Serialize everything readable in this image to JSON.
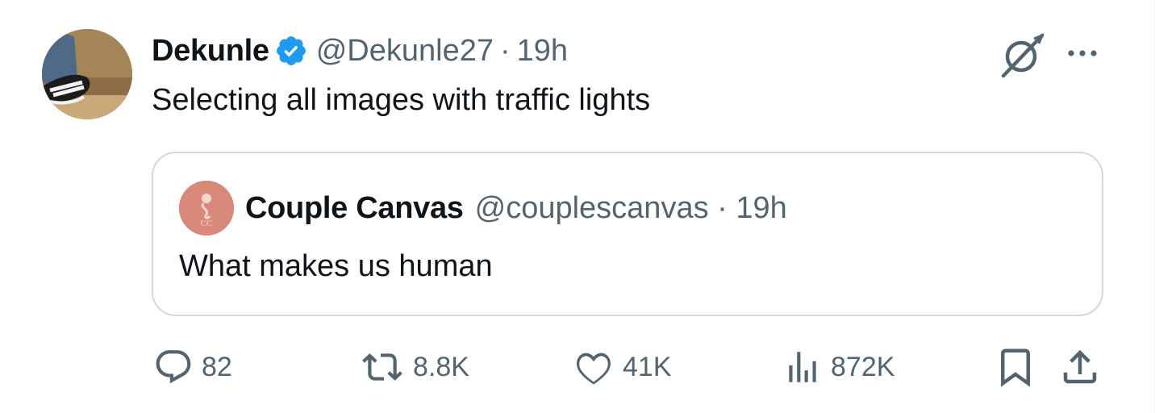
{
  "author": {
    "display_name": "Dekunle",
    "handle": "@Dekunle27",
    "separator": "·",
    "time": "19h",
    "verified": true
  },
  "tweet": {
    "text": "Selecting all images with traffic lights"
  },
  "quoted": {
    "display_name": "Couple Canvas",
    "handle_time": "@couplescanvas · 19h",
    "avatar_text": "CC",
    "text": "What makes us human"
  },
  "actions": {
    "replies": "82",
    "reposts": "8.8K",
    "likes": "41K",
    "views": "872K"
  },
  "icons": {
    "top_right": [
      "grok-icon",
      "more-icon"
    ],
    "actions": [
      "reply-icon",
      "repost-icon",
      "like-icon",
      "views-icon",
      "bookmark-icon",
      "share-icon"
    ]
  },
  "colors": {
    "text_primary": "#0f1419",
    "text_secondary": "#536471",
    "verified_blue": "#1d9bf0",
    "border": "#cfd9de"
  }
}
